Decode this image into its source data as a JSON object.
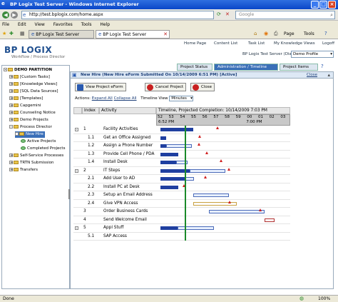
{
  "window": {
    "title": "BP Logix Test Server - Windows Internet Explorer"
  },
  "browser": {
    "url": "http://test.bplogix.com/home.aspx",
    "search_placeholder": "Google",
    "menu": [
      "File",
      "Edit",
      "View",
      "Favorites",
      "Tools",
      "Help"
    ],
    "tabs": [
      {
        "label": "BP Logix Test Server"
      },
      {
        "label": "BP Logix Test Server"
      }
    ],
    "toolbar": {
      "page": "Page",
      "tools": "Tools"
    },
    "status": "Done",
    "zoom": "100%"
  },
  "app": {
    "logo": "BP LOGIX",
    "logo_sub": "Workflow / Process Director",
    "toplinks": [
      "Home Page",
      "Content List",
      "Task List",
      "My Knowledge Views",
      "Logoff"
    ],
    "server_label": "BP Logix Test Server (Diana)",
    "profile_select": "Demo Profile",
    "nav_tabs": [
      "Project Status",
      "Administration / Timeline",
      "Project Items"
    ]
  },
  "tree": {
    "root": "DEMO PARTITION",
    "items": [
      {
        "label": "[Custom Tasks]",
        "level": 1,
        "expand": "+"
      },
      {
        "label": "[Knowledge Views]",
        "level": 1,
        "expand": "+"
      },
      {
        "label": "[SQL Data Sources]",
        "level": 1,
        "expand": "+"
      },
      {
        "label": "[Templates]",
        "level": 1,
        "expand": "+"
      },
      {
        "label": "Capgemini",
        "level": 1,
        "expand": "+"
      },
      {
        "label": "Counseling Notice",
        "level": 1,
        "expand": "+"
      },
      {
        "label": "Demo Projects",
        "level": 1,
        "expand": "+"
      },
      {
        "label": "Process Director",
        "level": 1,
        "expand": "-"
      },
      {
        "label": "New Hire",
        "level": 2,
        "expand": "-",
        "selected": true
      },
      {
        "label": "Active Projects",
        "level": 3,
        "expand": ""
      },
      {
        "label": "Completed Projects",
        "level": 3,
        "expand": ""
      },
      {
        "label": "Self-Service Processes",
        "level": 1,
        "expand": "+"
      },
      {
        "label": "TRTN Submission",
        "level": 1,
        "expand": "+"
      },
      {
        "label": "Transfers",
        "level": 1,
        "expand": "+"
      }
    ]
  },
  "panel": {
    "header": "New Hire (New Hire eForm Submitted On 10/14/2009 6:51 PM) [Active]",
    "close_link": "Close",
    "buttons": {
      "view": "View Project eForm",
      "cancel": "Cancel Project",
      "close": "Close"
    },
    "actions_label": "Actions:",
    "expand_all": "Expand All",
    "collapse_all": "Collapse All",
    "timeline_view_label": "Timeline View",
    "timeline_view_value": "Minutes",
    "columns": {
      "index": "Index",
      "activity": "Activity"
    },
    "timeline_title": "Timeline, Projected Completion: 10/14/2009 7:03 PM",
    "minute_ticks": [
      "52",
      "53",
      "54",
      "55",
      "56",
      "57",
      "58",
      "59",
      "00",
      "01",
      "02",
      "03"
    ],
    "time_left": "6:52 PM",
    "time_right": "7:00 PM"
  },
  "rows": [
    {
      "index": "1",
      "activity": "Facility Activities",
      "expand": "-",
      "indent": 0,
      "done": [
        0.4,
        3.3
      ],
      "plan": null,
      "marker": 5.5
    },
    {
      "index": "1.1",
      "activity": "Get an Office Assigned",
      "expand": "",
      "indent": 1,
      "done": [
        0.4,
        0.9
      ],
      "plan": null,
      "marker": 3.9
    },
    {
      "index": "1.2",
      "activity": "Assign a Phone Number",
      "expand": "",
      "indent": 1,
      "done": [
        0.4,
        0.9
      ],
      "plan": [
        0.9,
        3.2
      ],
      "marker": 3.8
    },
    {
      "index": "1.3",
      "activity": "Provide Cell Phone / PDA",
      "expand": "",
      "indent": 1,
      "done": [
        0.4,
        2.0
      ],
      "plan": null,
      "marker": 4.5
    },
    {
      "index": "1.4",
      "activity": "Install Desk",
      "expand": "",
      "indent": 1,
      "done": [
        0.4,
        1.8
      ],
      "plan": [
        1.8,
        2.8
      ],
      "marker": 5.8
    },
    {
      "index": "2",
      "activity": "IT Steps",
      "expand": "-",
      "indent": 0,
      "done": [
        0.4,
        3.0
      ],
      "plan": [
        3.0,
        6.2
      ],
      "marker": 6.5
    },
    {
      "index": "2.1",
      "activity": "Add User to AD",
      "expand": "",
      "indent": 1,
      "done": [
        0.4,
        2.6
      ],
      "plan": [
        2.6,
        3.4
      ],
      "marker": 4.4
    },
    {
      "index": "2.2",
      "activity": "Install PC at Desk",
      "expand": "",
      "indent": 1,
      "done": [
        0.4,
        2.0
      ],
      "plan": null,
      "marker": 2.5
    },
    {
      "index": "2.3",
      "activity": "Setup an Email Address",
      "expand": "",
      "indent": 1,
      "done": null,
      "plan": [
        3.3,
        6.5
      ],
      "marker": null
    },
    {
      "index": "2.4",
      "activity": "Give VPN Access",
      "expand": "",
      "indent": 1,
      "done": null,
      "late": [
        3.3,
        7.2
      ],
      "marker": 6.6
    },
    {
      "index": "3",
      "activity": "Order Business Cards",
      "expand": "",
      "indent": 0,
      "done": null,
      "plan": [
        4.7,
        9.7
      ],
      "marker": 9.3
    },
    {
      "index": "4",
      "activity": "Send Welcome Email",
      "expand": "",
      "indent": 0,
      "done": null,
      "crit": [
        9.7,
        10.6
      ],
      "marker": null
    },
    {
      "index": "5",
      "activity": "Appl Stuff",
      "expand": "-",
      "indent": 0,
      "done": [
        0.4,
        1.9
      ],
      "plan": [
        1.9,
        5.2
      ],
      "marker": null
    },
    {
      "index": "5.1",
      "activity": "SAP Access",
      "expand": "",
      "indent": 1,
      "done": null,
      "plan": null,
      "marker": null
    }
  ],
  "timeline": {
    "today_minute": 2.55,
    "minutes_span": 12
  }
}
